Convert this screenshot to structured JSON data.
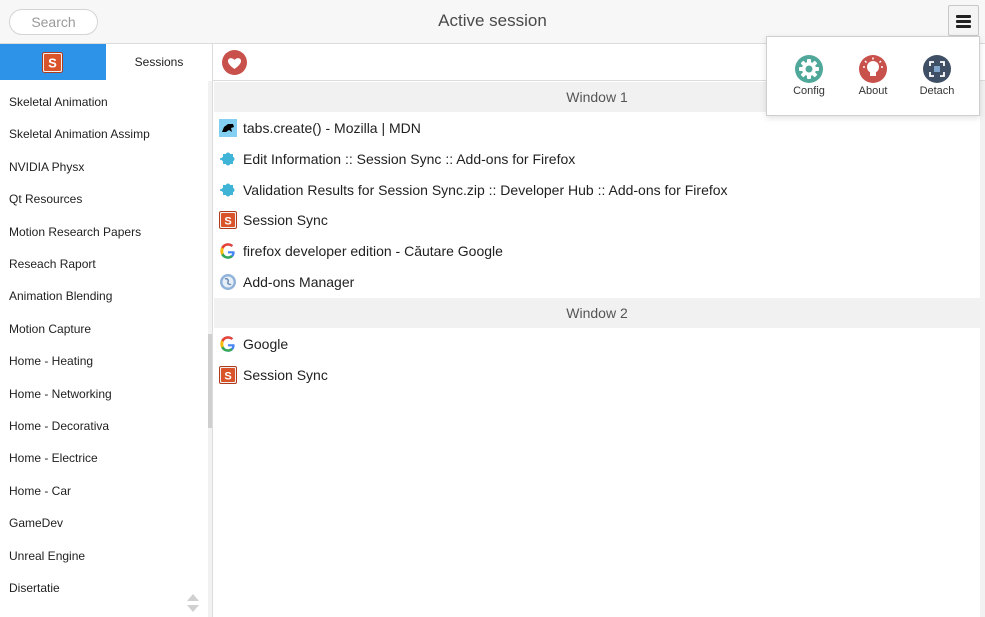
{
  "header": {
    "search_placeholder": "Search",
    "title": "Active session"
  },
  "sidebar": {
    "tabs": {
      "logo_letter": "S",
      "sessions_label": "Sessions"
    },
    "items": [
      "Skeletal Animation",
      "Skeletal Animation Assimp",
      "NVIDIA Physx",
      "Qt Resources",
      "Motion Research Papers",
      "Reseach Raport",
      "Animation Blending",
      "Motion Capture",
      "Home - Heating",
      "Home - Networking",
      "Home - Decorativa",
      "Home - Electrice",
      "Home - Car",
      "GameDev",
      "Unreal Engine",
      "Disertatie"
    ]
  },
  "popup": {
    "items": [
      {
        "label": "Config",
        "icon": "gear-icon",
        "color": "#4fa89a"
      },
      {
        "label": "About",
        "icon": "lightbulb-icon",
        "color": "#c9514b"
      },
      {
        "label": "Detach",
        "icon": "detach-icon",
        "color": "#3f4f66"
      }
    ]
  },
  "windows": [
    {
      "label": "Window 1",
      "tabs": [
        {
          "title": "tabs.create() - Mozilla | MDN",
          "icon": "mdn-dino-icon"
        },
        {
          "title": "Edit Information :: Session Sync :: Add-ons for Firefox",
          "icon": "puzzle-icon"
        },
        {
          "title": "Validation Results for Session Sync.zip :: Developer Hub :: Add-ons for Firefox",
          "icon": "puzzle-icon"
        },
        {
          "title": "Session Sync",
          "icon": "session-sync-icon"
        },
        {
          "title": "firefox developer edition - Căutare Google",
          "icon": "google-icon"
        },
        {
          "title": "Add-ons Manager",
          "icon": "addons-globe-icon"
        }
      ]
    },
    {
      "label": "Window 2",
      "tabs": [
        {
          "title": "Google",
          "icon": "google-icon"
        },
        {
          "title": "Session Sync",
          "icon": "session-sync-icon"
        }
      ]
    }
  ],
  "colors": {
    "accent_blue": "#2c93e8",
    "favorite_red": "#c9514b",
    "session_sync_orange": "#d9532b"
  }
}
